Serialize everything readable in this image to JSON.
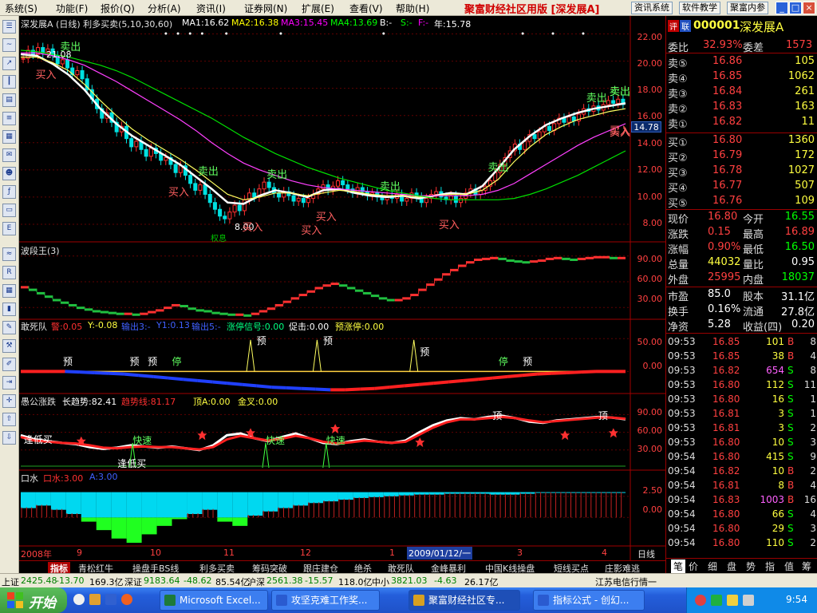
{
  "menu": {
    "items": [
      "系统(S)",
      "功能(F)",
      "报价(Q)",
      "分析(A)",
      "资讯(I)",
      "证券网(N)",
      "扩展(E)",
      "查看(V)",
      "帮助(H)"
    ],
    "app_title": "聚富财经社区用版 [深发展A]",
    "buttons": [
      "资讯系统",
      "软件教学",
      "聚富内参"
    ],
    "win_buttons": [
      "_",
      "□",
      "×"
    ]
  },
  "main_chart": {
    "title": "深发展A (日线) 利多买卖(5,10,30,60)",
    "ma": [
      {
        "label": "MA1:16.62",
        "color": "#ffffff"
      },
      {
        "label": "MA2:16.38",
        "color": "#ffff00"
      },
      {
        "label": "MA3:15.45",
        "color": "#ff00ff"
      },
      {
        "label": "MA4:13.69",
        "color": "#00ff00"
      }
    ],
    "extras": [
      "B:-",
      "S:-",
      "F:-",
      "年:15.78"
    ],
    "y_ticks": [
      "22.00",
      "20.00",
      "18.00",
      "16.00",
      "14.00",
      "12.00",
      "10.00",
      "8.00"
    ],
    "current_price": "14.78",
    "ylim": [
      7,
      22.5
    ],
    "signals": [
      {
        "text": "卖出",
        "kind": "sell",
        "i": 8
      },
      {
        "text": "买入",
        "kind": "buy",
        "i": 3
      },
      {
        "text": "卖出",
        "kind": "sell",
        "i": 36
      },
      {
        "text": "买入",
        "kind": "buy",
        "i": 30
      },
      {
        "text": "买入",
        "kind": "buy",
        "i": 45
      },
      {
        "text": "卖出",
        "kind": "sell",
        "i": 50
      },
      {
        "text": "买入",
        "kind": "buy",
        "i": 57
      },
      {
        "text": "买入",
        "kind": "buy",
        "i": 60
      },
      {
        "text": "卖出",
        "kind": "sell",
        "i": 73
      },
      {
        "text": "买入",
        "kind": "buy",
        "i": 85
      },
      {
        "text": "卖出",
        "kind": "sell",
        "i": 95
      },
      {
        "text": "卖出",
        "kind": "sell",
        "i": 115
      },
      {
        "text": "买入",
        "kind": "buy",
        "i": 120
      },
      {
        "text": "卖出",
        "kind": "sell",
        "i": 138
      },
      {
        "text": "买入",
        "kind": "buy",
        "i": 142
      },
      {
        "text": "卖出",
        "kind": "sell",
        "i": 170
      },
      {
        "text": "卖出",
        "kind": "sell",
        "i": 176
      },
      {
        "text": "买入",
        "kind": "buy",
        "i": 174
      }
    ],
    "annotations": [
      "21.08",
      "8.00",
      "权息"
    ]
  },
  "chart_data": [
    {
      "type": "line",
      "title": "深发展A (日线)",
      "note": "daily candlestick price chart with moving averages, approximated",
      "ylim": [
        7,
        22.5
      ],
      "close": [
        20.2,
        20.8,
        20.5,
        21.0,
        20.6,
        20.9,
        20.4,
        19.8,
        20.1,
        19.5,
        19.0,
        19.3,
        18.7,
        17.9,
        17.2,
        16.5,
        15.8,
        16.2,
        15.5,
        14.8,
        15.2,
        14.3,
        13.7,
        14.1,
        13.5,
        13.0,
        13.6,
        13.2,
        12.7,
        12.9,
        12.4,
        11.8,
        12.3,
        11.6,
        11.0,
        10.5,
        10.9,
        10.2,
        9.6,
        9.1,
        8.6,
        8.4,
        8.9,
        9.4,
        9.0,
        9.8,
        10.3,
        10.0,
        10.6,
        11.1,
        10.7,
        10.3,
        10.0,
        10.4,
        10.1,
        9.7,
        9.9,
        9.6,
        9.9,
        10.2,
        10.6,
        10.9,
        10.5,
        10.8,
        11.2,
        10.9,
        10.6,
        10.3,
        10.7,
        10.4,
        10.1,
        10.3,
        10.0,
        9.8,
        10.1,
        9.9,
        10.2,
        9.7,
        9.9,
        10.3,
        10.0,
        9.6,
        9.9,
        10.2,
        10.4,
        10.0,
        9.8,
        10.1,
        9.6,
        9.9,
        10.3,
        10.6,
        10.2,
        10.5,
        10.8,
        11.2,
        11.8,
        12.4,
        12.9,
        13.4,
        13.9,
        13.5,
        14.1,
        14.6,
        14.3,
        14.8,
        15.2,
        14.9,
        15.4,
        15.8,
        15.5,
        15.9,
        15.6,
        16.1,
        16.5,
        16.3,
        16.7,
        16.4,
        16.8,
        17.1,
        16.9,
        17.2,
        16.8
      ],
      "series": [
        {
          "name": "MA1",
          "values": [
            20.5,
            20.4,
            19.8,
            19.0,
            17.9,
            16.5,
            15.4,
            14.5,
            13.8,
            13.1,
            12.4,
            11.5,
            10.6,
            9.6,
            9.5,
            10.1,
            10.5,
            10.3,
            10.0,
            10.5,
            10.6,
            10.3,
            10.1,
            10.0,
            10.1,
            9.9,
            10.1,
            10.3,
            10.2,
            10.8,
            12.1,
            13.5,
            14.5,
            15.3,
            15.8,
            16.2,
            16.5,
            16.7,
            16.9
          ]
        },
        {
          "name": "MA2",
          "values": [
            20.3,
            20.3,
            19.9,
            19.3,
            18.3,
            17.1,
            16.0,
            15.0,
            14.2,
            13.5,
            12.8,
            12.0,
            11.1,
            10.2,
            9.8,
            10.0,
            10.3,
            10.3,
            10.1,
            10.3,
            10.5,
            10.4,
            10.2,
            10.1,
            10.1,
            10.0,
            10.1,
            10.2,
            10.2,
            10.5,
            11.3,
            12.6,
            13.7,
            14.6,
            15.2,
            15.7,
            16.0,
            16.3,
            16.5
          ]
        },
        {
          "name": "MA3",
          "values": [
            20.6,
            20.6,
            20.4,
            20.1,
            19.7,
            19.1,
            18.5,
            17.8,
            17.1,
            16.4,
            15.7,
            14.9,
            14.0,
            13.2,
            12.5,
            12.0,
            11.6,
            11.2,
            10.9,
            10.7,
            10.6,
            10.5,
            10.4,
            10.3,
            10.2,
            10.1,
            10.1,
            10.1,
            10.1,
            10.2,
            10.5,
            11.0,
            11.7,
            12.4,
            13.1,
            13.8,
            14.4,
            14.9,
            15.4
          ]
        },
        {
          "name": "MA4",
          "values": [
            20.8,
            20.7,
            20.5,
            20.3,
            20.0,
            19.7,
            19.3,
            18.8,
            18.2,
            17.6,
            17.0,
            16.4,
            15.8,
            15.1,
            14.4,
            13.8,
            13.2,
            12.7,
            12.2,
            11.8,
            11.4,
            11.1,
            10.8,
            10.5,
            10.3,
            10.1,
            9.9,
            9.8,
            9.8,
            9.8,
            9.8,
            9.9,
            10.2,
            10.6,
            11.1,
            11.6,
            12.2,
            12.8,
            13.4
          ]
        }
      ]
    },
    {
      "type": "line",
      "title": "波段王(3)",
      "ylim": [
        20,
        100
      ],
      "y_ticks": [
        "90.00",
        "60.00",
        "30.00"
      ],
      "values": [
        55,
        52,
        48,
        44,
        40,
        37,
        34,
        31,
        29,
        27,
        26,
        25,
        24,
        24,
        23,
        24,
        26,
        28,
        31,
        34,
        33,
        30,
        28,
        27,
        25,
        24,
        23,
        23,
        22,
        24,
        27,
        30,
        34,
        38,
        42,
        46,
        50,
        54,
        57,
        59,
        57,
        54,
        51,
        48,
        45,
        42,
        40,
        40,
        42,
        46,
        52,
        58,
        64,
        70,
        75,
        80,
        84,
        87,
        88,
        89,
        88,
        86,
        85,
        84,
        85,
        86,
        88,
        89,
        88,
        87,
        88,
        89,
        90,
        90,
        89,
        89
      ]
    },
    {
      "type": "line",
      "title": "敢死队",
      "ylim": [
        -30,
        60
      ],
      "y_ticks": [
        "50.00",
        "0.00"
      ],
      "values": [
        0,
        0,
        0,
        0,
        -1,
        -2,
        -3,
        -4,
        -6,
        -8,
        -10,
        -12,
        -14,
        -16,
        -18,
        -20,
        -22,
        -24,
        -25,
        -26,
        -27,
        -28,
        -28,
        -27,
        -26,
        -24,
        -22,
        -20,
        -18,
        -16,
        -14,
        -12,
        -10,
        -8,
        -6,
        -4,
        -3,
        -2,
        -1,
        0,
        0,
        0
      ]
    },
    {
      "type": "line",
      "title": "愚公涨跌",
      "ylim": [
        0,
        100
      ],
      "y_ticks": [
        "90.00",
        "60.00",
        "30.00"
      ],
      "series": [
        {
          "name": "长趋势",
          "values": [
            55,
            48,
            45,
            42,
            40,
            35,
            32,
            34,
            38,
            36,
            34,
            36,
            33,
            30,
            38,
            55,
            58,
            50,
            45,
            52,
            58,
            50,
            42,
            40,
            45,
            48,
            44,
            42,
            46,
            60,
            72,
            80,
            84,
            82,
            86,
            88,
            84,
            78,
            76,
            80,
            82,
            84,
            86,
            85,
            82
          ]
        },
        {
          "name": "趋势线",
          "values": [
            52,
            46,
            44,
            42,
            41,
            38,
            34,
            33,
            35,
            36,
            35,
            35,
            33,
            31,
            35,
            48,
            54,
            50,
            46,
            49,
            54,
            50,
            44,
            41,
            43,
            46,
            44,
            42,
            44,
            56,
            68,
            77,
            82,
            82,
            84,
            86,
            84,
            80,
            77,
            79,
            81,
            83,
            85,
            85,
            83
          ]
        }
      ]
    },
    {
      "type": "bar",
      "title": "口水",
      "ylim": [
        -3,
        4
      ],
      "y_ticks": [
        "2.50",
        "0.00"
      ],
      "values": [
        1.2,
        1.5,
        1.0,
        0.5,
        -0.5,
        -1.5,
        -2.5,
        -3.0,
        -2.0,
        -1.0,
        -0.2,
        0.5,
        1.0,
        -0.5,
        -1.0,
        0.3,
        0.8,
        1.2,
        1.5,
        1.8,
        2.0,
        2.2,
        2.4,
        2.5,
        2.6,
        2.7,
        2.8,
        2.8,
        2.9,
        2.9,
        2.9,
        2.8,
        2.8,
        2.9,
        3.0,
        3.0,
        3.0,
        3.0,
        3.0,
        3.0
      ]
    }
  ],
  "sub1": {
    "title": "波段王(3)"
  },
  "sub2": {
    "title": "敢死队",
    "items": [
      {
        "text": "警:0.05",
        "color": "#ff3030"
      },
      {
        "text": "Y:-0.08",
        "color": "#ffff40"
      },
      {
        "text": "输出3:-",
        "color": "#4060ff"
      },
      {
        "text": "Y1:0.13",
        "color": "#4060ff"
      },
      {
        "text": "输出5:-",
        "color": "#4060ff"
      },
      {
        "text": "涨停信号:0.00",
        "color": "#00ff80"
      },
      {
        "text": "促击:0.00",
        "color": "#ffffff"
      },
      {
        "text": "预涨停:0.00",
        "color": "#ffff40"
      }
    ],
    "markers": [
      "预",
      "预",
      "预",
      "停",
      "预",
      "预",
      "预",
      "停",
      "预"
    ]
  },
  "sub3": {
    "title": "愚公涨跌",
    "items": [
      {
        "text": "长趋势:82.41",
        "color": "#ffffff"
      },
      {
        "text": "趋势线:81.17",
        "color": "#ff3030"
      },
      {
        "text": "顶A:0.00",
        "color": "#ffff40"
      },
      {
        "text": "金叉:0.00",
        "color": "#ffff40"
      }
    ],
    "markers": [
      "逢低买",
      "快速",
      "逢低买",
      "快速",
      "快速",
      "顶",
      "顶"
    ]
  },
  "sub4": {
    "title": "口水",
    "items": [
      {
        "text": "口水:3.00",
        "color": "#ff3030"
      },
      {
        "text": "A:3.00",
        "color": "#4060ff"
      }
    ]
  },
  "xaxis": {
    "labels": [
      "2008年",
      "9",
      "10",
      "11",
      "12",
      "1",
      "2009/01/12/一",
      "3",
      "4"
    ],
    "period": "日线"
  },
  "tabs": [
    "指标",
    "青松红牛",
    "操盘手BS线",
    "利多买卖",
    "筹码突破",
    "跟庄建仓",
    "绝杀",
    "敢死队",
    "金峰暴利",
    "中国K线操盘",
    "短线买点",
    "庄影难逃"
  ],
  "quote": {
    "tag1": "评",
    "tag2": "联",
    "code": "000001",
    "name": "深发展A",
    "weibi_label": "委比",
    "weibi": "32.93%",
    "weicha_label": "委差",
    "weicha": "1573",
    "asks": [
      {
        "label": "卖⑤",
        "price": "16.86",
        "vol": "105"
      },
      {
        "label": "卖④",
        "price": "16.85",
        "vol": "1062"
      },
      {
        "label": "卖③",
        "price": "16.84",
        "vol": "261"
      },
      {
        "label": "卖②",
        "price": "16.83",
        "vol": "163"
      },
      {
        "label": "卖①",
        "price": "16.82",
        "vol": "11"
      }
    ],
    "bids": [
      {
        "label": "买①",
        "price": "16.80",
        "vol": "1360"
      },
      {
        "label": "买②",
        "price": "16.79",
        "vol": "172"
      },
      {
        "label": "买③",
        "price": "16.78",
        "vol": "1027"
      },
      {
        "label": "买④",
        "price": "16.77",
        "vol": "507"
      },
      {
        "label": "买⑤",
        "price": "16.76",
        "vol": "109"
      }
    ],
    "stats": [
      {
        "l1": "现价",
        "v1": "16.80",
        "c1": "#ff4040",
        "l2": "今开",
        "v2": "16.55",
        "c2": "#00ff00"
      },
      {
        "l1": "涨跌",
        "v1": "0.15",
        "c1": "#ff4040",
        "l2": "最高",
        "v2": "16.89",
        "c2": "#ff4040"
      },
      {
        "l1": "涨幅",
        "v1": "0.90%",
        "c1": "#ff4040",
        "l2": "最低",
        "v2": "16.50",
        "c2": "#00ff00"
      },
      {
        "l1": "总量",
        "v1": "44032",
        "c1": "#ffff40",
        "l2": "量比",
        "v2": "0.95",
        "c2": "#ffffff"
      },
      {
        "l1": "外盘",
        "v1": "25995",
        "c1": "#ff4040",
        "l2": "内盘",
        "v2": "18037",
        "c2": "#00ff00"
      },
      {
        "l1": "市盈",
        "v1": "85.0",
        "c1": "#ffffff",
        "l2": "股本",
        "v2": "31.1亿",
        "c2": "#ffffff"
      },
      {
        "l1": "换手",
        "v1": "0.16%",
        "c1": "#ffffff",
        "l2": "流通",
        "v2": "27.8亿",
        "c2": "#ffffff"
      },
      {
        "l1": "净资",
        "v1": "5.28",
        "c1": "#ffffff",
        "l2": "收益(四)",
        "v2": "0.20",
        "c2": "#ffffff"
      }
    ],
    "ticks": [
      {
        "t": "09:53",
        "p": "16.85",
        "v": "101",
        "s": "B",
        "n": "8"
      },
      {
        "t": "09:53",
        "p": "16.85",
        "v": "38",
        "s": "B",
        "n": "4"
      },
      {
        "t": "09:53",
        "p": "16.82",
        "v": "654",
        "s": "S",
        "n": "8"
      },
      {
        "t": "09:53",
        "p": "16.80",
        "v": "112",
        "s": "S",
        "n": "11"
      },
      {
        "t": "09:53",
        "p": "16.80",
        "v": "16",
        "s": "S",
        "n": "1"
      },
      {
        "t": "09:53",
        "p": "16.81",
        "v": "3",
        "s": "S",
        "n": "1"
      },
      {
        "t": "09:53",
        "p": "16.81",
        "v": "3",
        "s": "S",
        "n": "2"
      },
      {
        "t": "09:53",
        "p": "16.80",
        "v": "10",
        "s": "S",
        "n": "3"
      },
      {
        "t": "09:54",
        "p": "16.80",
        "v": "415",
        "s": "S",
        "n": "9"
      },
      {
        "t": "09:54",
        "p": "16.82",
        "v": "10",
        "s": "B",
        "n": "2"
      },
      {
        "t": "09:54",
        "p": "16.81",
        "v": "8",
        "s": "B",
        "n": "4"
      },
      {
        "t": "09:54",
        "p": "16.83",
        "v": "1003",
        "s": "B",
        "n": "16"
      },
      {
        "t": "09:54",
        "p": "16.80",
        "v": "66",
        "s": "S",
        "n": "4"
      },
      {
        "t": "09:54",
        "p": "16.80",
        "v": "29",
        "s": "S",
        "n": "3"
      },
      {
        "t": "09:54",
        "p": "16.80",
        "v": "110",
        "s": "S",
        "n": "2"
      }
    ],
    "tabs": [
      "笔",
      "价",
      "细",
      "盘",
      "势",
      "指",
      "值",
      "筹"
    ]
  },
  "status": {
    "sh_label": "上证",
    "sh_val": "2425.48",
    "sh_chg": "-13.70",
    "sh_amt": "169.3亿",
    "sz_label": "深证",
    "sz_val": "9183.64",
    "sz_chg": "-48.62",
    "sz_amt": "85.54亿",
    "hs_label": "沪深",
    "hs_val": "2561.38",
    "hs_chg": "-15.57",
    "hs_amt": "118.0亿",
    "zx_label": "中小",
    "zx_val": "3821.03",
    "zx_chg": "-4.63",
    "zx_amt": "26.17亿",
    "isp": "江苏电信行情一"
  },
  "taskbar": {
    "start": "开始",
    "tasks": [
      "Microsoft Excel...",
      "攻坚克难工作奖...",
      "聚富财经社区专...",
      "指标公式 - 创幻..."
    ],
    "clock": "9:54"
  }
}
